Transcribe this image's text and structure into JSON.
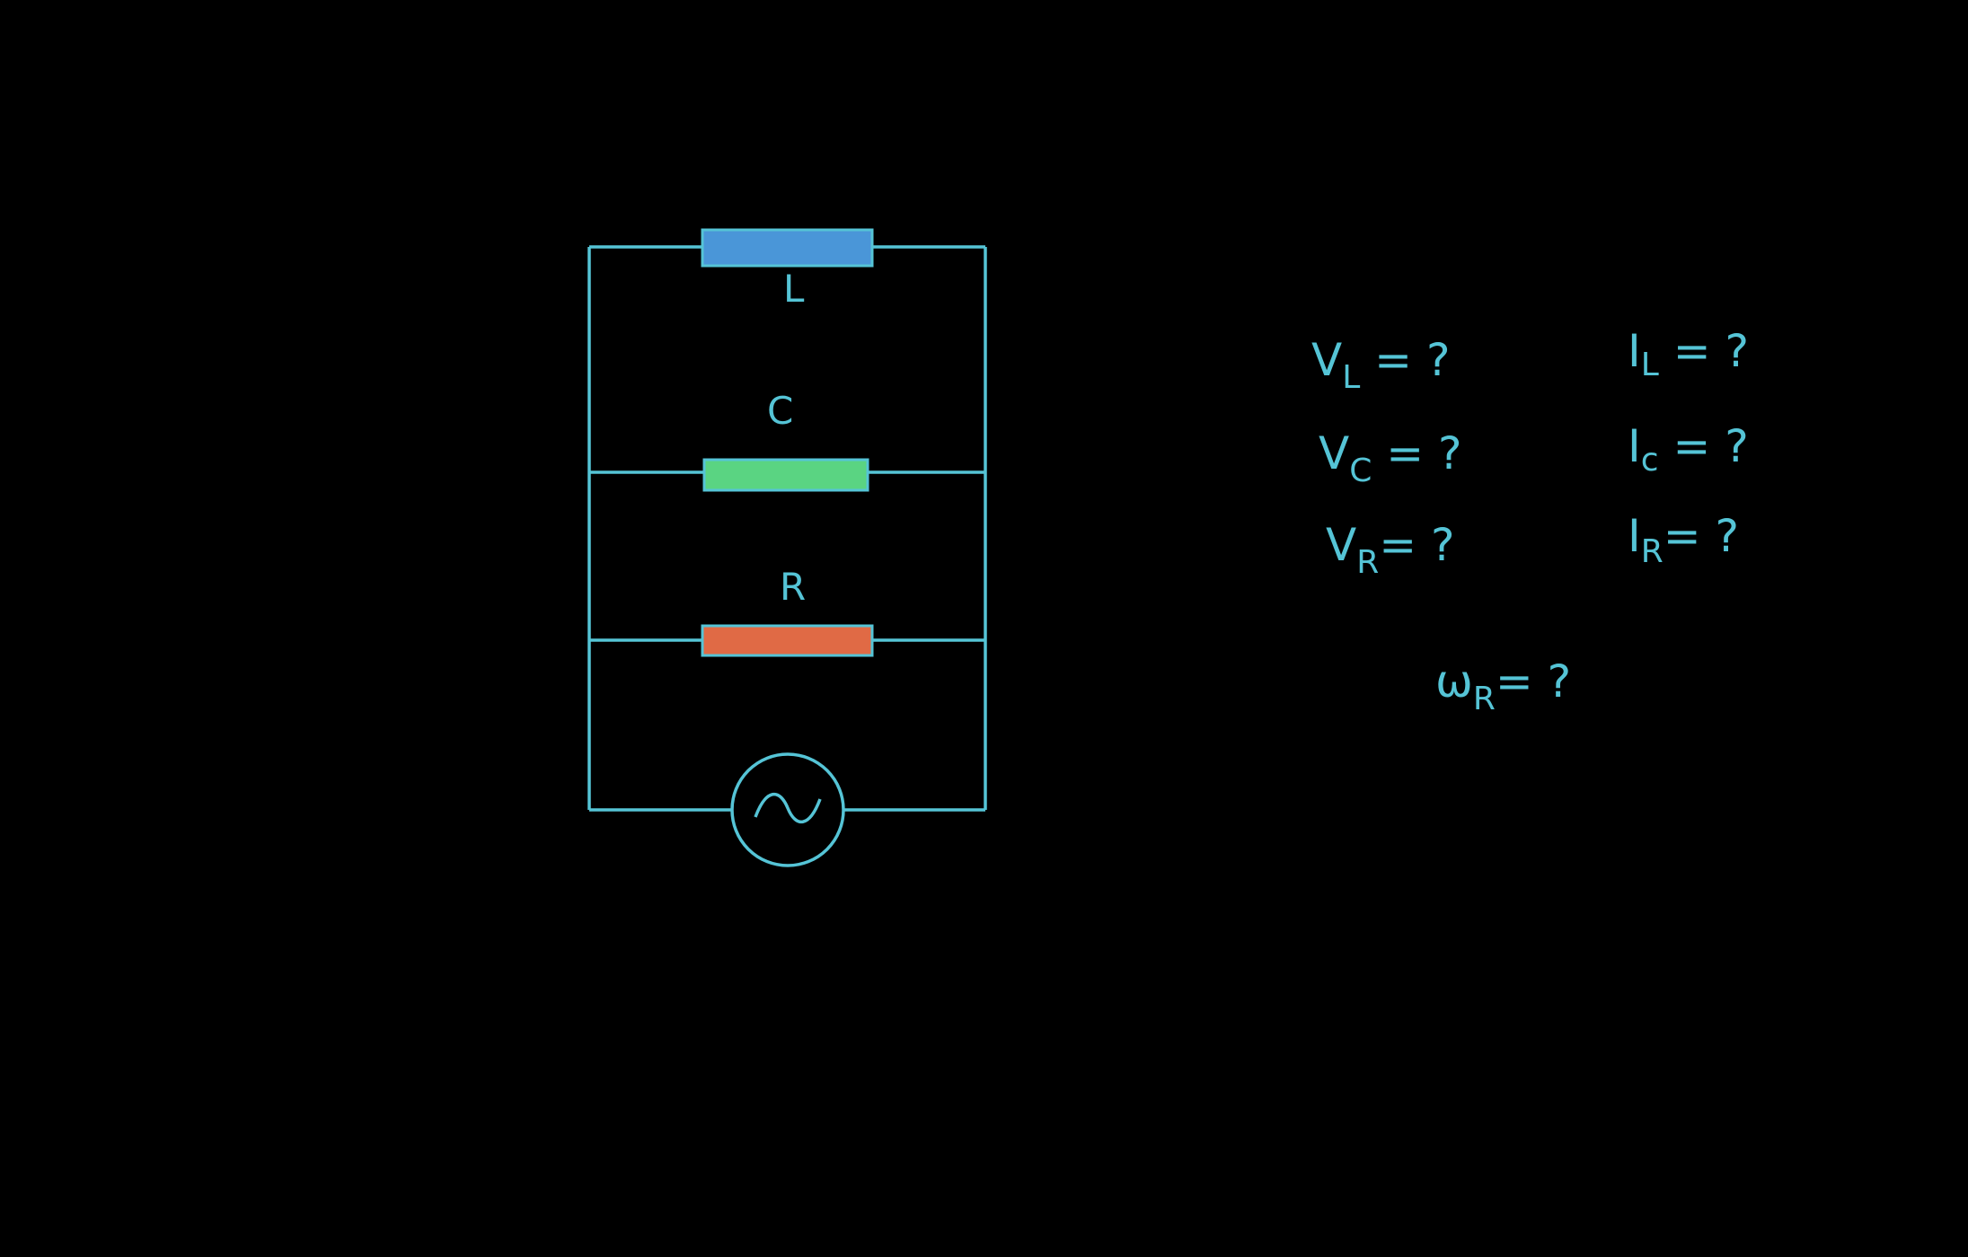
{
  "colors": {
    "background": "#000000",
    "wire": "#55c4d6",
    "text": "#55c4d6",
    "inductor": "#4a96d8",
    "capacitor": "#5ad482",
    "resistor": "#e06a45"
  },
  "components": {
    "inductor_label": "L",
    "capacitor_label": "C",
    "resistor_label": "R",
    "source_icon": "ac-source-icon"
  },
  "unknowns": {
    "vl": {
      "main": "V",
      "sub": "L",
      "rest": " = ?"
    },
    "vc": {
      "main": "V",
      "sub": "C",
      "rest": " = ?"
    },
    "vr": {
      "main": "V",
      "sub": "R",
      "rest": "= ?"
    },
    "il": {
      "main": "I",
      "sub": "L",
      "rest": " = ?"
    },
    "ic": {
      "main": "I",
      "sub": "c",
      "rest": " = ?"
    },
    "ir": {
      "main": "I",
      "sub": "R",
      "rest": "= ?"
    },
    "wr": {
      "main": "ω",
      "sub": "R",
      "rest": "= ?"
    }
  }
}
